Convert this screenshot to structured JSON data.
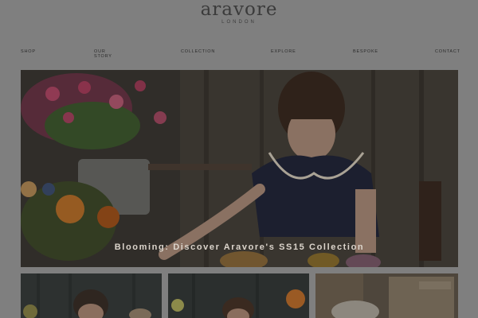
{
  "brand": {
    "name": "aravore",
    "location": "LONDON"
  },
  "nav": {
    "items": [
      {
        "label": "SHOP"
      },
      {
        "label": "OUR STORY"
      },
      {
        "label": "COLLECTION"
      },
      {
        "label": "EXPLORE"
      },
      {
        "label": "BESPOKE"
      },
      {
        "label": "CONTACT"
      }
    ]
  },
  "hero": {
    "caption": "Blooming: Discover Aravore's SS15 Collection"
  }
}
